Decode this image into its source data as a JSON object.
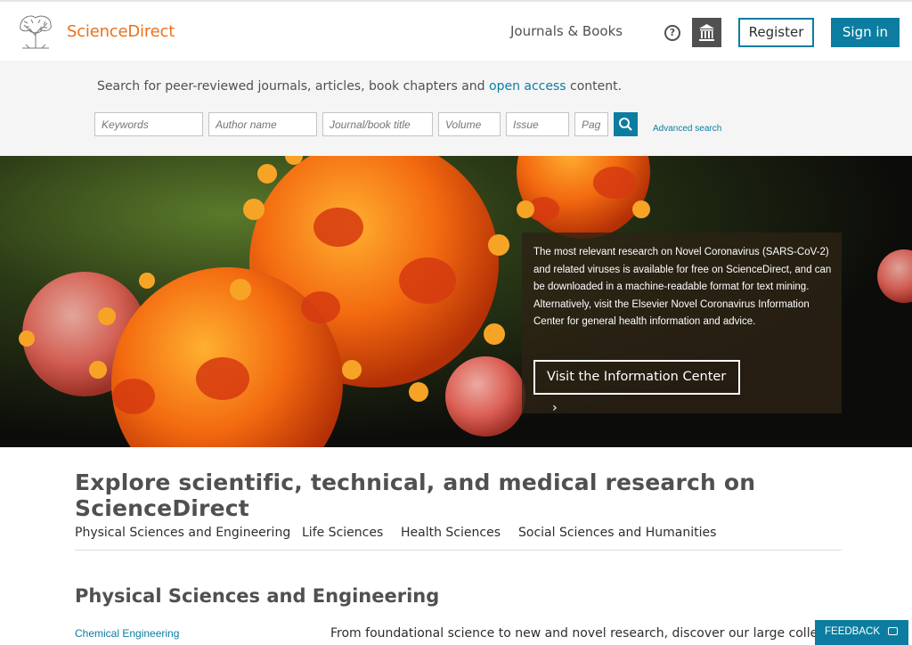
{
  "header": {
    "brand": "ScienceDirect",
    "nav_journals": "Journals & Books",
    "help_icon": "help-circle-icon",
    "institution_icon": "institution-icon",
    "register_label": "Register",
    "signin_label": "Sign in"
  },
  "search": {
    "intro_before": "Search for peer-reviewed journals, articles, book chapters and ",
    "intro_link": "open access",
    "intro_after": " content.",
    "keywords_placeholder": "Keywords",
    "author_placeholder": "Author name",
    "journal_placeholder": "Journal/book title",
    "volume_placeholder": "Volume",
    "issue_placeholder": "Issue",
    "pages_placeholder": "Pag",
    "search_icon": "search-icon",
    "advanced_label": "Advanced search"
  },
  "hero": {
    "text_line1": "The most relevant research on Novel Coronavirus (SARS-CoV-2) and related viruses is available for free on ScienceDirect, and can be downloaded in a machine-readable format for text mining.",
    "text_line2": "Alternatively, visit the Elsevier Novel Coronavirus Information Center for general health information and advice.",
    "button_label": "Visit the Information Center"
  },
  "explore": {
    "title": "Explore scientific, technical, and medical research on ScienceDirect",
    "tabs": [
      "Physical Sciences and Engineering",
      "Life Sciences",
      "Health Sciences",
      "Social Sciences and Humanities"
    ],
    "section_title": "Physical Sciences and Engineering",
    "first_category": "Chemical Engineering",
    "section_desc": "From foundational science to new and novel research, discover our large collection"
  },
  "feedback_label": "FEEDBACK",
  "colors": {
    "brand_orange": "#e9711c",
    "accent_blue": "#0c7da0"
  }
}
